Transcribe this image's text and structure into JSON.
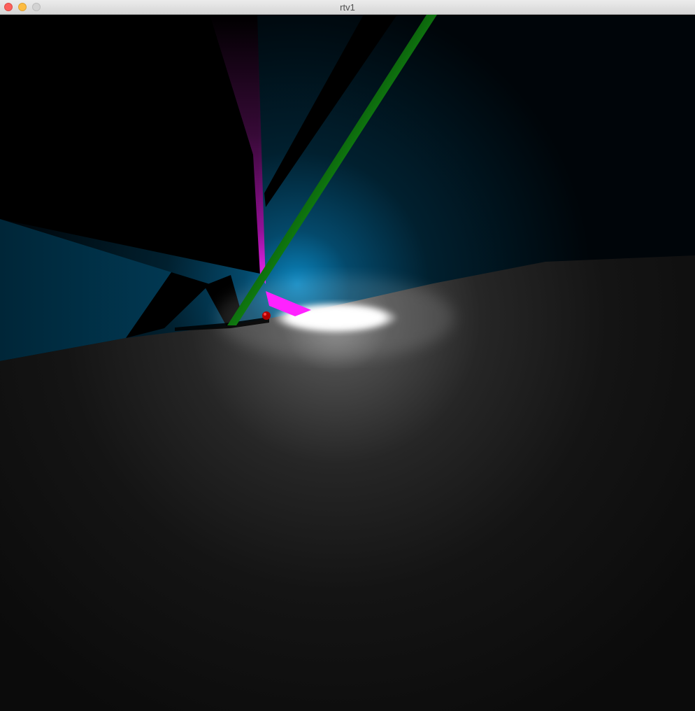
{
  "window": {
    "title": "rtv1"
  },
  "scene": {
    "wall_color": "#00aaff",
    "floor_color": "#ffffff",
    "cone_color": "#ff00ff",
    "cylinder_color": "#00ff00",
    "sphere_color": "#ff0000",
    "background_color": "#000000"
  }
}
